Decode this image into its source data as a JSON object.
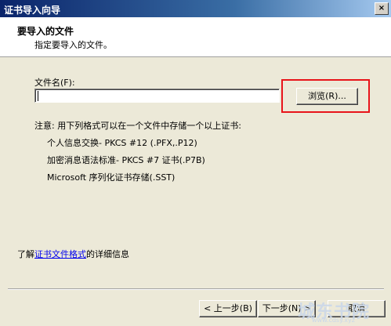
{
  "window": {
    "title": "证书导入向导",
    "close_glyph": "×"
  },
  "header": {
    "title": "要导入的文件",
    "subtitle": "指定要导入的文件。"
  },
  "file": {
    "label": "文件名(F):",
    "value": "",
    "browse_label": "浏览(R)..."
  },
  "note": {
    "heading": "注意: 用下列格式可以在一个文件中存储一个以上证书:",
    "formats": [
      "个人信息交换- PKCS #12 (.PFX,.P12)",
      "加密消息语法标准- PKCS #7 证书(.P7B)",
      "Microsoft 序列化证书存储(.SST)"
    ]
  },
  "more_info": {
    "prefix": "了解",
    "link": "证书文件格式",
    "suffix": "的详细信息"
  },
  "footer": {
    "back_label": "< 上一步(B)",
    "next_label": "下一步(N) >",
    "cancel_label": "取消"
  },
  "watermark": {
    "text": "城东书院",
    "url": "www.cdsy.xyz"
  },
  "colors": {
    "highlight": "#e8141a",
    "link": "#0000ee",
    "title_bar": "#0a246a"
  }
}
